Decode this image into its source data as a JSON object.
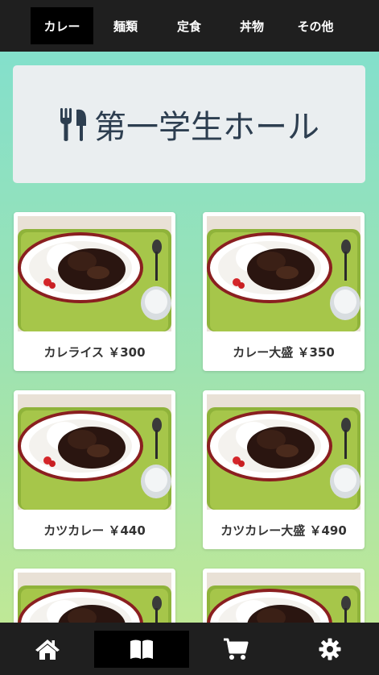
{
  "tabs": [
    {
      "label": "カレー",
      "active": true
    },
    {
      "label": "麺類",
      "active": false
    },
    {
      "label": "定食",
      "active": false
    },
    {
      "label": "丼物",
      "active": false
    },
    {
      "label": "その他",
      "active": false
    }
  ],
  "banner": {
    "icon": "utensils-icon",
    "title": "第一学生ホール"
  },
  "menu": {
    "items": [
      {
        "name": "カレライス",
        "price": "￥300",
        "caption": "カレライス ￥300"
      },
      {
        "name": "カレー大盛",
        "price": "￥350",
        "caption": "カレー大盛 ￥350"
      },
      {
        "name": "カツカレー",
        "price": "￥440",
        "caption": "カツカレー ￥440"
      },
      {
        "name": "カツカレー大盛",
        "price": "￥490",
        "caption": "カツカレー大盛 ￥490"
      }
    ]
  },
  "bottom_nav": [
    {
      "icon": "home-icon",
      "active": false
    },
    {
      "icon": "book-icon",
      "active": true
    },
    {
      "icon": "cart-icon",
      "active": false
    },
    {
      "icon": "gear-icon",
      "active": false
    }
  ],
  "colors": {
    "bar_background": "#1f1f1f",
    "active_background": "#000000",
    "title_text": "#2d3e50",
    "gradient_top": "#7fdfd0",
    "gradient_bottom": "#c6e991"
  }
}
